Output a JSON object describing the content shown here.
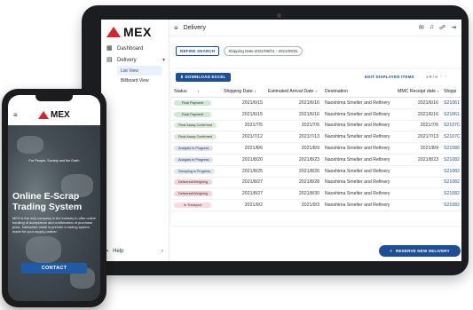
{
  "app": {
    "brand": "MEX",
    "page_title": "Delivery"
  },
  "sidebar": {
    "items": [
      {
        "label": "Dashboard",
        "icon": "grid-icon"
      },
      {
        "label": "Delivery",
        "icon": "table-icon"
      }
    ],
    "sub_items": [
      {
        "label": "List View",
        "active": true
      },
      {
        "label": "Billboard View",
        "active": false
      }
    ],
    "help_label": "Help"
  },
  "toolbar": {
    "refine_label": "REFINE SEARCH",
    "filter_chip": "Shipping Date:2021/06/01 - 2021/09/31",
    "download_label": "DOWNLOAD EXCEL",
    "edit_label": "EDIT DISPLAYED ITEMS",
    "pager_text": "1-9 / 9"
  },
  "table": {
    "columns": [
      "Status",
      "Shipping Date",
      "Estimated Arrival Date",
      "Destination",
      "MMC Receipt date",
      "Shippi"
    ],
    "rows": [
      {
        "status": "Final Payment",
        "status_color": "#cfe9d4",
        "shipping": "2021/6/15",
        "arrival": "2021/6/16",
        "dest": "Naoshima Smelter and Refinery",
        "receipt": "2021/6/16",
        "ship_no": "S21061"
      },
      {
        "status": "Final Payment",
        "status_color": "#cfe9d4",
        "shipping": "2021/6/15",
        "arrival": "2021/6/16",
        "dest": "Naoshima Smelter and Refinery",
        "receipt": "2021/6/16",
        "ship_no": "S21061"
      },
      {
        "status": "Final Assay Confirmed",
        "status_color": "#dcebd8",
        "shipping": "2021/7/5",
        "arrival": "2021/7/6",
        "dest": "Naoshima Smelter and Refinery",
        "receipt": "2021/7/6",
        "ship_no": "S2107C"
      },
      {
        "status": "Final Assay Confirmed",
        "status_color": "#dcebd8",
        "shipping": "2021/7/12",
        "arrival": "2021/7/13",
        "dest": "Naoshima Smelter and Refinery",
        "receipt": "2021/7/13",
        "ship_no": "S2107C"
      },
      {
        "status": "Analysis in Progress",
        "status_color": "#dde3f3",
        "shipping": "2021/8/6",
        "arrival": "2021/8/9",
        "dest": "Naoshima Smelter and Refinery",
        "receipt": "2021/8/9",
        "ship_no": "S21080"
      },
      {
        "status": "Analysis in Progress",
        "status_color": "#dde3f3",
        "shipping": "2021/8/20",
        "arrival": "2021/8/23",
        "dest": "Naoshima Smelter and Refinery",
        "receipt": "2021/8/23",
        "ship_no": "S21082"
      },
      {
        "status": "Sampling in Progress",
        "status_color": "#dbe8f5",
        "shipping": "2021/8/25",
        "arrival": "2021/8/26",
        "dest": "Naoshima Smelter and Refinery",
        "receipt": "",
        "ship_no": "S21082"
      },
      {
        "status": "Delivered/Weighing",
        "status_color": "#f6d4d6",
        "shipping": "2021/8/27",
        "arrival": "2021/8/28",
        "dest": "Naoshima Smelter and Refinery",
        "receipt": "",
        "ship_no": "S21082"
      },
      {
        "status": "Delivered/Weighing",
        "status_color": "#f6d4d6",
        "shipping": "2021/8/27",
        "arrival": "2021/8/30",
        "dest": "Naoshima Smelter and Refinery",
        "receipt": "",
        "ship_no": "S21082"
      },
      {
        "status": "In Transport",
        "status_color": "#f9d9dc",
        "shipping": "2021/9/2",
        "arrival": "2021/9/3",
        "dest": "Naoshima Smelter and Refinery",
        "receipt": "",
        "ship_no": "S21082"
      }
    ]
  },
  "fab": {
    "label": "RESERVE NEW DELIVERY"
  },
  "phone": {
    "brand": "MEX",
    "tagline": "For People, Society and the Earth",
    "title_line1": "Online E-Scrap",
    "title_line2": "Trading System",
    "description": "MEX is the only company in the industry to offer online booking of acceptance and confirmation of purchase price. Interactive metal is premier a trading system made for your supply partner.",
    "cta": "CONTACT"
  },
  "colors": {
    "accent": "#1e4f96",
    "brand_red": "#d8232a"
  }
}
